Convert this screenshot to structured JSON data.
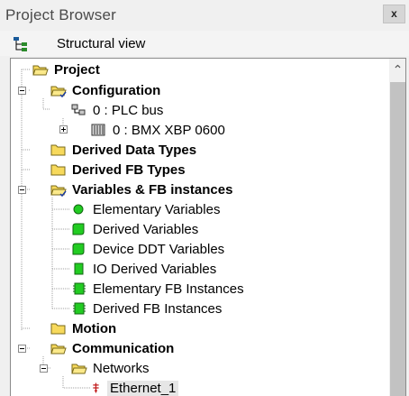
{
  "window": {
    "title": "Project Browser",
    "close_label": "x"
  },
  "view": {
    "label": "Structural view"
  },
  "tree": {
    "project": "Project",
    "configuration": "Configuration",
    "plc_bus": "0 : PLC bus",
    "rack": "0 : BMX XBP 0600",
    "derived_data_types": "Derived Data Types",
    "derived_fb_types": "Derived FB Types",
    "variables": "Variables & FB instances",
    "elementary_variables": "Elementary Variables",
    "derived_variables": "Derived Variables",
    "device_ddt_variables": "Device DDT Variables",
    "io_derived_variables": "IO Derived Variables",
    "elementary_fb_instances": "Elementary FB Instances",
    "derived_fb_instances": "Derived FB Instances",
    "motion": "Motion",
    "communication": "Communication",
    "networks": "Networks",
    "ethernet": "Ethernet_1"
  },
  "icons": {
    "folder": "folder-icon",
    "folder_open": "folder-open-icon",
    "variable": "green-variable-icon",
    "plc_bus": "plc-bus-icon",
    "rack": "rack-icon",
    "network": "network-icon"
  },
  "colors": {
    "folder": "#f7d95c",
    "variable": "#22cc22",
    "selected_bg": "#e6e6e6"
  }
}
